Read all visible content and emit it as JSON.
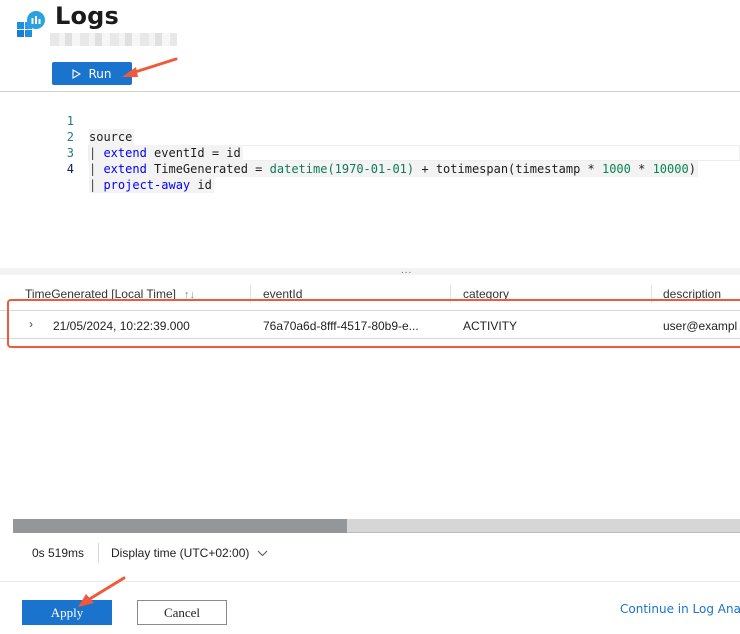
{
  "header": {
    "title": "Logs",
    "icon": "log-analytics-icon"
  },
  "toolbar": {
    "run_label": "Run",
    "run_icon": "play-icon"
  },
  "editor": {
    "lines": [
      {
        "number": "1",
        "text": "source"
      },
      {
        "number": "2",
        "pipe": "| ",
        "keyword": "extend",
        "rest": " eventId = id"
      },
      {
        "number": "3",
        "pipe": "| ",
        "keyword": "extend",
        "mid": " TimeGenerated = ",
        "fn1": "datetime(1970-01-01)",
        "op": " + totimespan(timestamp * ",
        "n1": "1000",
        "op2": " * ",
        "n2": "10000",
        "close": ")"
      },
      {
        "number": "4",
        "pipe": "| ",
        "keyword": "project-away",
        "rest": " id"
      }
    ]
  },
  "splitter": {
    "label": "..."
  },
  "results": {
    "columns": [
      {
        "label": "TimeGenerated [Local Time]",
        "sort_icon": "↑↓"
      },
      {
        "label": "eventId"
      },
      {
        "label": "category"
      },
      {
        "label": "description"
      }
    ],
    "rows": [
      {
        "expand_icon": "›",
        "cells": [
          "21/05/2024, 10:22:39.000",
          "76a70a6d-8fff-4517-80b9-e...",
          "ACTIVITY",
          "user@exampl"
        ]
      }
    ],
    "horizontal_scroll_fraction": 0.46
  },
  "status": {
    "elapsed": "0s 519ms",
    "display_time": "Display time (UTC+02:00)",
    "display_time_icon": "chevron-down-icon"
  },
  "footer": {
    "apply_label": "Apply",
    "cancel_label": "Cancel",
    "continue_label": "Continue in Log Anal"
  },
  "colors": {
    "accent": "#1a73cc",
    "annotation": "#ef5a3c",
    "keyword": "#0000ff",
    "function": "#0f7a5a",
    "line_number": "#237893"
  }
}
